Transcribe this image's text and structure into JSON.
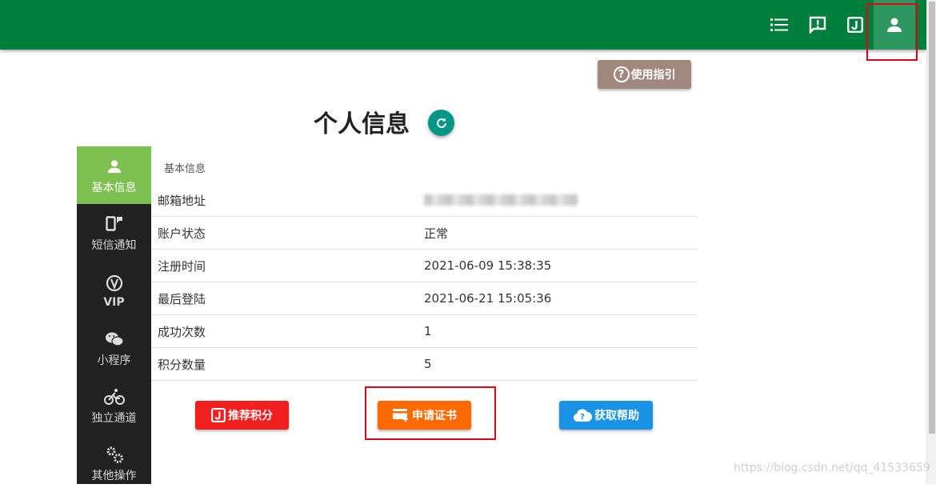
{
  "topbar": {
    "icons": [
      "list-icon",
      "feedback-icon",
      "j-icon",
      "person-icon"
    ]
  },
  "guide_button": {
    "label": "使用指引"
  },
  "page_title": "个人信息",
  "sidebar": {
    "items": [
      {
        "label": "基本信息",
        "icon": "person-icon",
        "active": true
      },
      {
        "label": "短信通知",
        "icon": "sms-icon",
        "active": false
      },
      {
        "label": "VIP",
        "icon": "vip-icon",
        "active": false
      },
      {
        "label": "小程序",
        "icon": "wechat-icon",
        "active": false
      },
      {
        "label": "独立通道",
        "icon": "bike-icon",
        "active": false
      },
      {
        "label": "其他操作",
        "icon": "gears-icon",
        "active": false
      }
    ]
  },
  "section_label": "基本信息",
  "info": [
    {
      "key": "邮箱地址",
      "value": ""
    },
    {
      "key": "账户状态",
      "value": "正常"
    },
    {
      "key": "注册时间",
      "value": "2021-06-09 15:38:35"
    },
    {
      "key": "最后登陆",
      "value": "2021-06-21 15:05:36"
    },
    {
      "key": "成功次数",
      "value": "1"
    },
    {
      "key": "积分数量",
      "value": "5"
    }
  ],
  "actions": {
    "recommend": "推荐积分",
    "cert": "申请证书",
    "help": "获取帮助"
  },
  "watermark": "https://blog.csdn.net/qq_41533659",
  "colors": {
    "topbar": "#007f3c",
    "sidebar": "#212121",
    "sidebar_active": "#7cc14f",
    "guide": "#a1887f",
    "refresh": "#009688",
    "recommend": "#f21f1f",
    "cert": "#ff6a00",
    "help": "#1a93e6",
    "highlight": "#e60012"
  }
}
